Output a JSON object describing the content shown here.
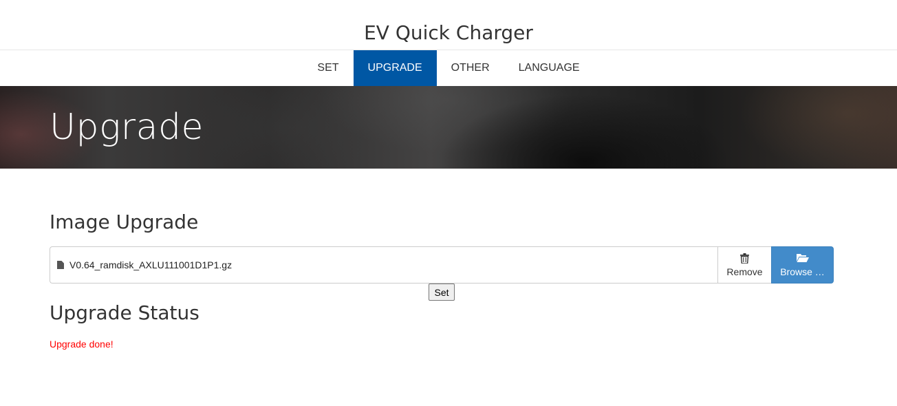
{
  "header": {
    "title": "EV Quick Charger"
  },
  "nav": {
    "items": [
      {
        "label": "SET"
      },
      {
        "label": "UPGRADE"
      },
      {
        "label": "OTHER"
      },
      {
        "label": "LANGUAGE"
      }
    ],
    "active": "UPGRADE",
    "active_color": "#0057a4"
  },
  "banner": {
    "title": "Upgrade"
  },
  "image_upgrade": {
    "title": "Image Upgrade",
    "file_name": "V0.64_ramdisk_AXLU111001D1P1.gz",
    "file_icon": "file-icon",
    "remove_label": "Remove",
    "remove_icon": "trash-icon",
    "browse_label": "Browse …",
    "browse_icon": "folder-open-icon",
    "browse_color": "#428bca",
    "set_label": "Set"
  },
  "upgrade_status": {
    "title": "Upgrade Status",
    "message": "Upgrade done!",
    "message_color": "#ff0000"
  }
}
